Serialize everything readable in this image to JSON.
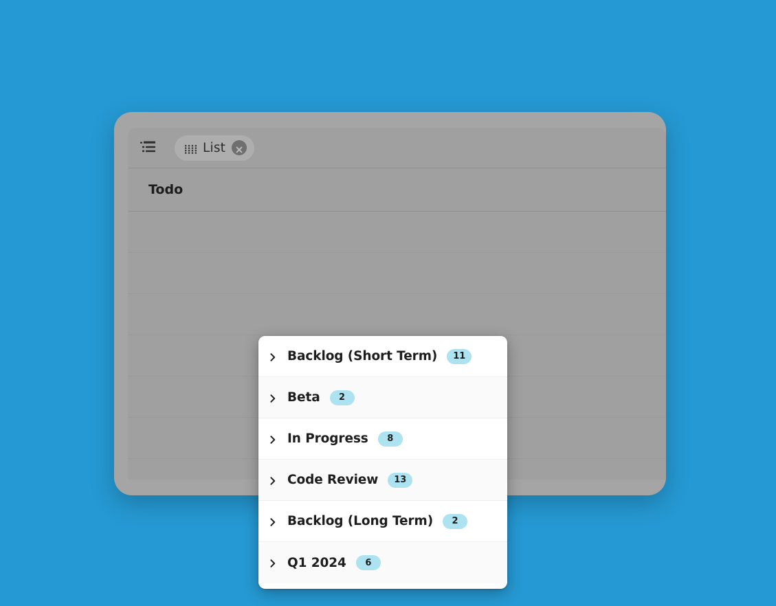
{
  "background": {
    "color": "#2599d3"
  },
  "window": {
    "card_color": "#a5a5a5",
    "panel_color": "#a0a0a0"
  },
  "toolbar": {
    "outline_icon": "outline-list-icon",
    "view_chip": {
      "grid_icon": "grid-dots-icon",
      "label": "List",
      "close_icon": "close-circle-icon"
    }
  },
  "group_header": {
    "title": "Todo"
  },
  "table": {
    "row_count": 7
  },
  "dropdown": {
    "accent_badge_color": "#ade3f0",
    "items": [
      {
        "label": "Backlog (Short Term)",
        "count": "11",
        "chevron": "chevron-right-icon"
      },
      {
        "label": "Beta",
        "count": "2",
        "chevron": "chevron-right-icon"
      },
      {
        "label": "In Progress",
        "count": "8",
        "chevron": "chevron-right-icon"
      },
      {
        "label": "Code Review",
        "count": "13",
        "chevron": "chevron-right-icon"
      },
      {
        "label": "Backlog (Long Term)",
        "count": "2",
        "chevron": "chevron-right-icon"
      },
      {
        "label": "Q1 2024",
        "count": "6",
        "chevron": "chevron-right-icon"
      }
    ]
  }
}
